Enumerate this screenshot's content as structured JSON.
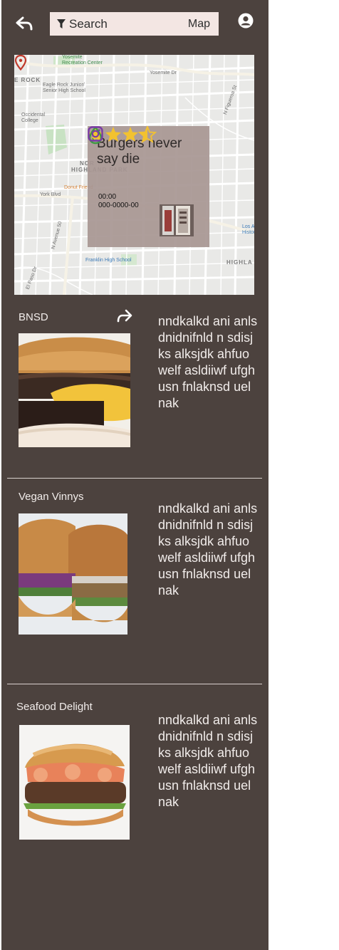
{
  "header": {
    "back_icon": "reply-arrow-icon",
    "search": {
      "placeholder": "Search",
      "value": "",
      "icon": "filter-icon"
    },
    "map_toggle": "Map",
    "profile_icon": "user-circle-icon"
  },
  "map": {
    "labels": {
      "yosemite": "Yosemite\nRecreation Center",
      "rock": "E ROCK",
      "eagle": "Eagle Rock Junior/\nSenior High School",
      "occidental": "Occidental\nCollege",
      "highland1": "NOR",
      "highland2": "HIGHLAND PARK",
      "donut": "Donut Friend",
      "yorkblvd": "York Blvd",
      "franklin": "Franklin High School",
      "losa": "Los A\nHistoric",
      "highl": "HIGHLA",
      "yosemitedr": "Yosemite Dr",
      "figueroa": "N Figueroa St",
      "avenue50": "N Avenue 50",
      "elpaso": "El Paso Dr"
    },
    "popup": {
      "title": "Burgers never say die",
      "rating": 3.5,
      "rating_max": 5,
      "time": "00:00",
      "phone": "000-0000-00",
      "icons": [
        "star-icon",
        "water-drop-icon",
        "instagram-icon"
      ]
    }
  },
  "listings": [
    {
      "name": "BNSD",
      "description": "nndkalkd ani anlsdnidnifnld n sdisjks alksjdk ahfuowelf asldiiwf ufghusn fnlaknsd uelnak",
      "share_icon": "share-arrow-icon"
    },
    {
      "name": "Vegan Vinnys",
      "description": "nndkalkd ani anlsdnidnifnld n sdisjks alksjdk ahfuowelf asldiiwf ufghusn fnlaknsd uelnak"
    },
    {
      "name": "Seafood Delight",
      "description": "nndkalkd ani anlsdnidnifnld n sdisjks alksjdk ahfuowelf asldiiwf ufghusn fnlaknsd uelnak"
    }
  ],
  "colors": {
    "background": "#4c423e",
    "text": "#f1ecea",
    "search_bg": "#f3e6e3",
    "star": "#f2c230",
    "water": "#3f9b44",
    "instagram": "#7a3aa6",
    "pin": "#c0392b"
  }
}
